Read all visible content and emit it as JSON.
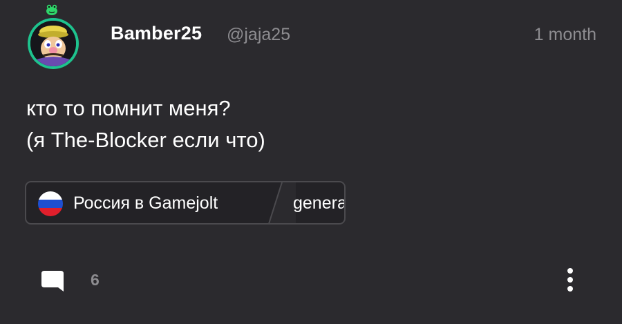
{
  "post": {
    "author": {
      "display_name": "Bamber25",
      "handle": "@jaja25",
      "avatar_icon": "avatar-wario-icon"
    },
    "timestamp": "1 month",
    "text_lines": [
      "кто то помнит меня?",
      "(я The-Blocker если что)"
    ],
    "community": {
      "name": "Россия в Gamejolt",
      "channel": "general",
      "icon": "russia-flag-icon"
    },
    "comments": {
      "count": "6",
      "icon": "comment-bubble-icon"
    },
    "more_icon": "more-vertical-icon"
  },
  "colors": {
    "background": "#2b2a2e",
    "avatar_ring": "#1ec38e",
    "muted_text": "#8d8c90",
    "pill_border": "#4b4a4e"
  }
}
